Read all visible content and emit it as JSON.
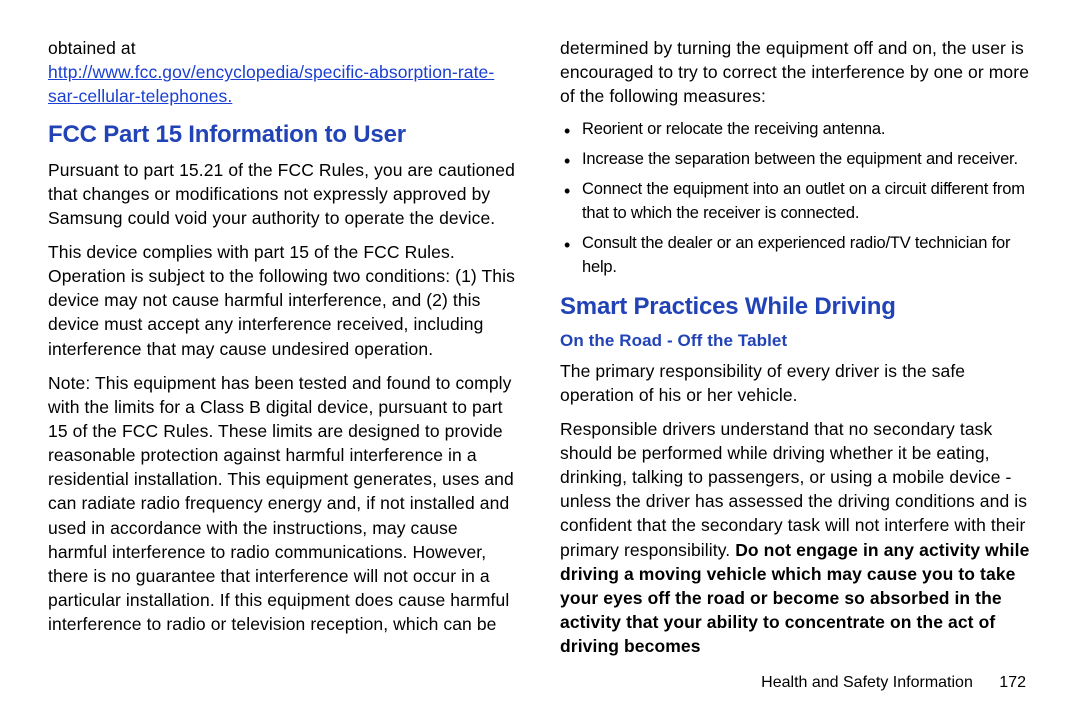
{
  "col1": {
    "obtained_at": "obtained at",
    "link_text": "http://www.fcc.gov/encyclopedia/specific-absorption-rate-sar-cellular-telephones.",
    "h2_fcc": "FCC Part 15 Information to User",
    "p1": "Pursuant to part 15.21 of the FCC Rules, you are cautioned that changes or modifications not expressly approved by Samsung could void your authority to operate the device.",
    "p2": "This device complies with part 15 of the FCC Rules. Operation is subject to the following two conditions: (1) This device may not cause harmful interference, and (2) this device must accept any interference received, including interference that may cause undesired operation.",
    "p3": "Note: This equipment has been tested and found to comply with the limits for a Class B digital device, pursuant to part 15 of the FCC Rules. These limits are designed to provide reasonable protection against harmful interference in a residential installation. This equipment generates, uses and can radiate radio frequency energy and, if not installed and used in accordance with the instructions, may cause harmful interference to radio communications. However, there is no guarantee that interference will not occur in a particular installation. If this equipment does cause harmful interference to radio or television reception, which can be"
  },
  "col2": {
    "p_continue": "determined by turning the equipment off and on, the user is encouraged to try to correct the interference by one or more of the following measures:",
    "bullets": [
      "Reorient or relocate the receiving antenna.",
      "Increase the separation between the equipment and receiver.",
      "Connect the equipment into an outlet on a circuit different from that to which the receiver is connected.",
      "Consult the dealer or an experienced radio/TV technician for help."
    ],
    "h2_smart": "Smart Practices While Driving",
    "h3_road": "On the Road - Off the Tablet",
    "p_drive1": "The primary responsibility of every driver is the safe operation of his or her vehicle.",
    "p_drive2_pre": "Responsible drivers understand that no secondary task should be performed while driving whether it be eating, drinking, talking to passengers, or using a mobile device - unless the driver has assessed the driving conditions and is confident that the secondary task will not interfere with their primary responsibility. ",
    "p_drive2_bold": "Do not engage in any activity while driving a moving vehicle which may cause you to take your eyes off the road or become so absorbed in the activity that your ability to concentrate on the act of driving becomes"
  },
  "footer": {
    "label": "Health and Safety Information",
    "page": "172"
  }
}
